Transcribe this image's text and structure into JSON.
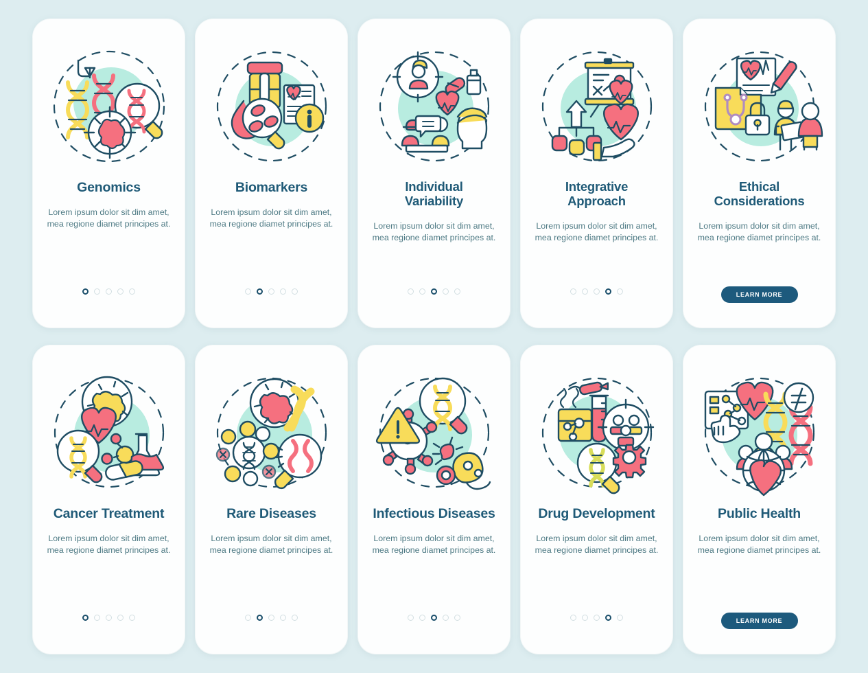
{
  "page": {
    "background_color": "#ddedf0",
    "card_background": "#fdfefe",
    "title_color": "#1f5a77",
    "body_color": "#4e7a84",
    "accent_color": "#1d5a7d",
    "palette": {
      "mint": "#b8ece0",
      "pink": "#f5707f",
      "yellow": "#f8dc5a",
      "ink": "#1f4d63",
      "white": "#ffffff"
    }
  },
  "shared": {
    "body_text": "Lorem ipsum dolor sit dim amet, mea regione diamet principes at.",
    "learn_more_label": "LEARN MORE",
    "dot_count": 5
  },
  "rows": [
    {
      "name": "top-row",
      "cards": [
        {
          "title": "Genomics",
          "title_lines": [
            "Genomics"
          ],
          "body": "Lorem ipsum dolor sit dim amet, mea regione diamet principes at.",
          "icon": "genomics-illustration",
          "footer": "dots",
          "active_dot": 1,
          "dot_count": 5
        },
        {
          "title": "Biomarkers",
          "title_lines": [
            "Biomarkers"
          ],
          "body": "Lorem ipsum dolor sit dim amet, mea regione diamet principes at.",
          "icon": "biomarkers-illustration",
          "footer": "dots",
          "active_dot": 2,
          "dot_count": 5
        },
        {
          "title": "Individual Variability",
          "title_lines": [
            "Individual",
            "Variability"
          ],
          "body": "Lorem ipsum dolor sit dim amet, mea regione diamet principes at.",
          "icon": "individual-variability-illustration",
          "footer": "dots",
          "active_dot": 3,
          "dot_count": 5
        },
        {
          "title": "Integrative Approach",
          "title_lines": [
            "Integrative",
            "Approach"
          ],
          "body": "Lorem ipsum dolor sit dim amet, mea regione diamet principes at.",
          "icon": "integrative-approach-illustration",
          "footer": "dots",
          "active_dot": 4,
          "dot_count": 5
        },
        {
          "title": "Ethical Considerations",
          "title_lines": [
            "Ethical",
            "Considerations"
          ],
          "body": "Lorem ipsum dolor sit dim amet, mea regione diamet principes at.",
          "icon": "ethical-considerations-illustration",
          "footer": "button",
          "button_label": "LEARN MORE"
        }
      ]
    },
    {
      "name": "bottom-row",
      "cards": [
        {
          "title": "Cancer Treatment",
          "title_lines": [
            "Cancer Treatment"
          ],
          "body": "Lorem ipsum dolor sit dim amet, mea regione diamet principes at.",
          "icon": "cancer-treatment-illustration",
          "footer": "dots",
          "active_dot": 1,
          "dot_count": 5
        },
        {
          "title": "Rare Diseases",
          "title_lines": [
            "Rare Diseases"
          ],
          "body": "Lorem ipsum dolor sit dim amet, mea regione diamet principes at.",
          "icon": "rare-diseases-illustration",
          "footer": "dots",
          "active_dot": 2,
          "dot_count": 5
        },
        {
          "title": "Infectious Diseases",
          "title_lines": [
            "Infectious Diseases"
          ],
          "body": "Lorem ipsum dolor sit dim amet, mea regione diamet principes at.",
          "icon": "infectious-diseases-illustration",
          "footer": "dots",
          "active_dot": 3,
          "dot_count": 5
        },
        {
          "title": "Drug Development",
          "title_lines": [
            "Drug Development"
          ],
          "body": "Lorem ipsum dolor sit dim amet, mea regione diamet principes at.",
          "icon": "drug-development-illustration",
          "footer": "dots",
          "active_dot": 4,
          "dot_count": 5
        },
        {
          "title": "Public Health",
          "title_lines": [
            "Public Health"
          ],
          "body": "Lorem ipsum dolor sit dim amet, mea regione diamet principes at.",
          "icon": "public-health-illustration",
          "footer": "button",
          "button_label": "LEARN MORE"
        }
      ]
    }
  ]
}
